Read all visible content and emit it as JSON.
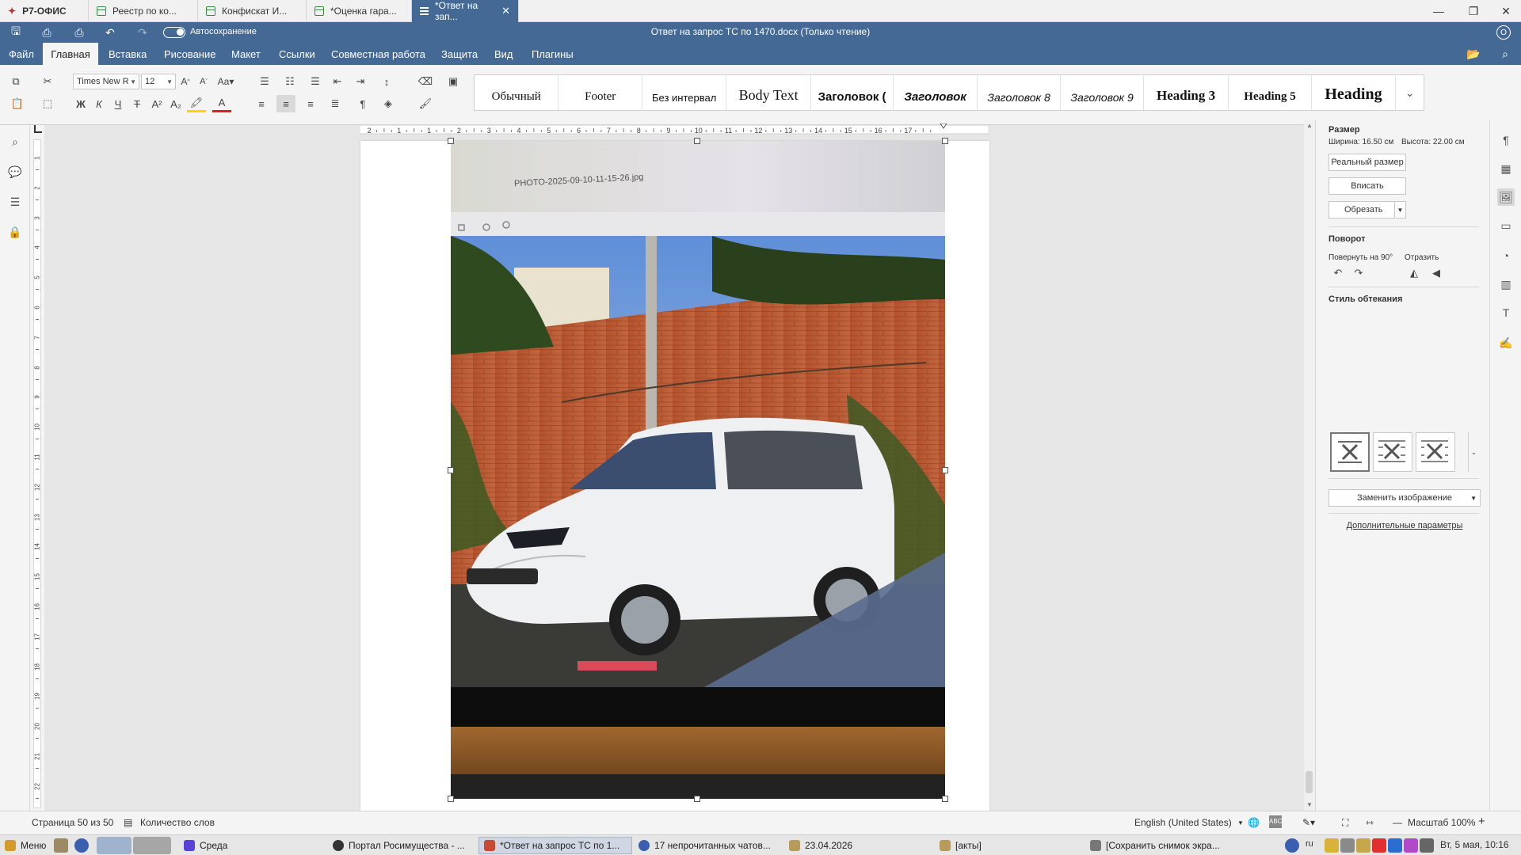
{
  "app": {
    "brand": "Р7-ОФИС"
  },
  "tabs": [
    {
      "label": "Реестр по ко..."
    },
    {
      "label": "Конфискат И..."
    },
    {
      "label": "*Оценка гара..."
    },
    {
      "label": "*Ответ на зап..."
    }
  ],
  "titlebar": {
    "autosave_label": "Автосохранение",
    "doc_title": "Ответ на запрос ТС по 1470.docx (Только чтение)",
    "user_initial": "О"
  },
  "menu": [
    "Файл",
    "Главная",
    "Вставка",
    "Рисование",
    "Макет",
    "Ссылки",
    "Совместная работа",
    "Защита",
    "Вид",
    "Плагины"
  ],
  "font": {
    "name": "Times New R",
    "size": "12"
  },
  "format_buttons": {
    "bold": "Ж",
    "italic": "К",
    "underline": "Ч",
    "strike": "Т"
  },
  "styles": [
    "Обычный",
    "Footer",
    "Без интервал",
    "Body Text",
    "Заголовок (",
    "Заголовок",
    "Заголовок 8",
    "Заголовок 9",
    "Heading 3",
    "Heading 5",
    "Heading"
  ],
  "photo": {
    "filename": "PHOTO-2025-09-10-11-15-26.jpg"
  },
  "panel": {
    "size_title": "Размер",
    "width_text": "Ширина: 16.50 см",
    "height_text": "Высота: 22.00 см",
    "real_size": "Реальный размер",
    "fit": "Вписать",
    "crop": "Обрезать",
    "rotation_title": "Поворот",
    "rotate90": "Повернуть на 90°",
    "flip": "Отразить",
    "wrap_title": "Стиль обтекания",
    "replace_image": "Заменить изображение",
    "more_params": "Дополнительные параметры"
  },
  "ruler": {
    "h_ticks": [
      "2",
      "1",
      "1",
      "2",
      "3",
      "4",
      "5",
      "6",
      "7",
      "8",
      "9",
      "10",
      "11",
      "12",
      "13",
      "14",
      "15",
      "16",
      "17"
    ],
    "v_ticks": [
      "1",
      "2",
      "3",
      "4",
      "5",
      "6",
      "7",
      "8",
      "9",
      "10",
      "11",
      "12",
      "13",
      "14",
      "15",
      "16",
      "17",
      "18",
      "19",
      "20",
      "21",
      "22"
    ]
  },
  "status": {
    "page": "Страница 50 из 50",
    "word_count": "Количество слов",
    "language": "English (United States)",
    "zoom": "Масштаб 100%"
  },
  "taskbar": {
    "menu": "Меню",
    "items": [
      "Среда",
      "Портал Росимущества - ...",
      "*Ответ на запрос ТС по 1...",
      "17 непрочитанных чатов...",
      "23.04.2026",
      "[акты]",
      "[Сохранить снимок экра..."
    ],
    "lang": "ru",
    "clock": "Вт, 5 мая, 10:16"
  },
  "colors": {
    "accent": "#446995",
    "brick": "#b5512f",
    "car": "#eef0f2"
  }
}
